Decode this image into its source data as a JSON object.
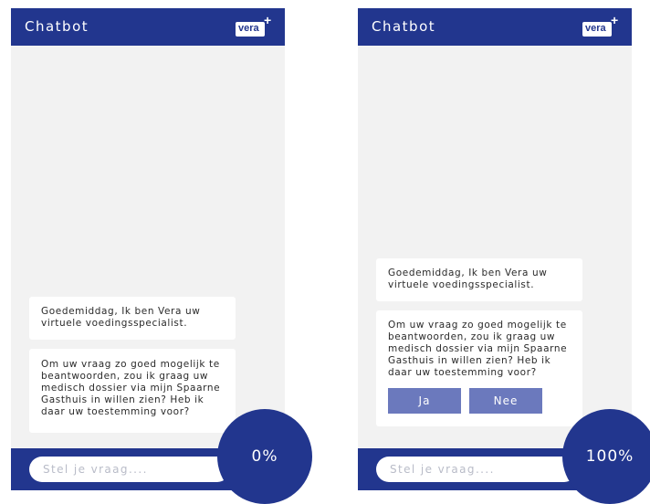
{
  "screens": [
    {
      "header": {
        "title": "Chatbot",
        "logo_text": "vera",
        "logo_plus": "+"
      },
      "messages": [
        "Goedemiddag, Ik ben Vera uw\nvirtuele voedingsspecialist.",
        "Om uw vraag zo goed mogelijk te\nbeantwoorden, zou ik graag uw\nmedisch dossier via mijn Spaarne\nGasthuis in willen zien? Heb ik\ndaar uw toestemming voor?"
      ],
      "input_placeholder": "Stel je vraag....",
      "progress_label": "0%",
      "progress": 0
    },
    {
      "header": {
        "title": "Chatbot",
        "logo_text": "vera",
        "logo_plus": "+"
      },
      "messages": [
        "Goedemiddag, Ik ben Vera uw\nvirtuele voedingsspecialist.",
        "Om uw vraag zo goed mogelijk te\nbeantwoorden, zou ik graag uw\nmedisch dossier via mijn Spaarne\nGasthuis in willen zien? Heb ik\ndaar uw toestemming voor?"
      ],
      "quick_replies": [
        "Ja",
        "Nee"
      ],
      "input_placeholder": "Stel je vraag....",
      "progress_label": "100%",
      "progress": 100
    }
  ],
  "colors": {
    "brand_blue": "#22368e",
    "button_blue": "#6b79bd",
    "chat_background": "#f2f2f2",
    "bubble": "#ffffff",
    "placeholder": "#b9bcc8"
  },
  "icons": {
    "logo": "vera-logo-icon"
  }
}
